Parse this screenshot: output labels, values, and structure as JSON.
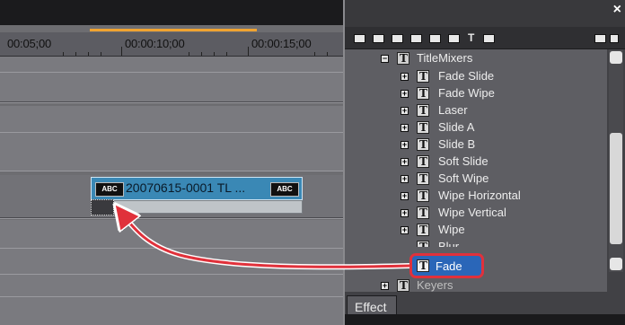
{
  "timeline": {
    "timecodes": [
      "00:05;00",
      "00:00:10;00",
      "00:00:15;00"
    ],
    "clip": {
      "left_badge": "ABC",
      "right_badge": "ABC",
      "title": "20070615-0001  TL ..."
    }
  },
  "palette": {
    "close_glyph": "×",
    "tree": {
      "folder_label": "TitleMixers",
      "items": [
        {
          "label": "Fade Slide"
        },
        {
          "label": "Fade Wipe"
        },
        {
          "label": "Laser"
        },
        {
          "label": "Slide A"
        },
        {
          "label": "Slide B"
        },
        {
          "label": "Soft Slide"
        },
        {
          "label": "Soft Wipe"
        },
        {
          "label": "Wipe Horizontal"
        },
        {
          "label": "Wipe Vertical"
        },
        {
          "label": "Wipe"
        }
      ],
      "blur_label": "Blur",
      "selected_label": "Fade",
      "keyers_label": "Keyers"
    },
    "tab_label": "Effect"
  },
  "colors": {
    "accent_orange": "#f0a330",
    "highlight_red": "#e0313b",
    "selection_blue": "#2a66b8",
    "clip_blue": "#3a88b5"
  }
}
